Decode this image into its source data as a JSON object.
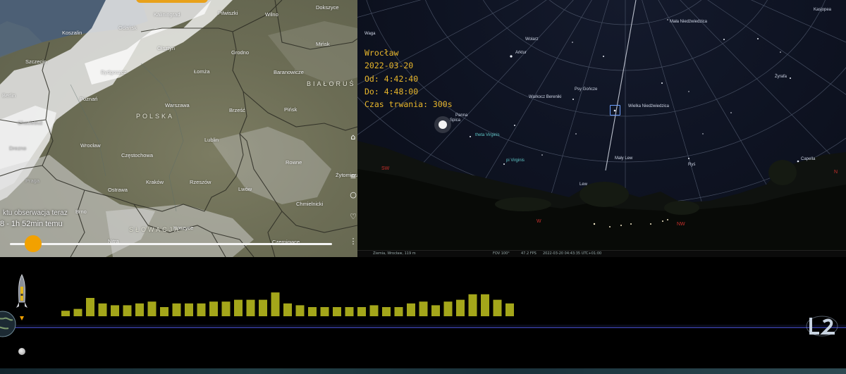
{
  "map": {
    "country_labels": [
      "POLSKA",
      "BIAŁORUŚ",
      "SŁOWACJA"
    ],
    "cities": [
      "Kaliningrad",
      "Pilwiszki",
      "Wilno",
      "Dokszyce",
      "Koszalin",
      "Gdańsk",
      "Olsztyn",
      "Grodno",
      "Mińsk",
      "Szczecin",
      "Bydgoszcz",
      "Łomża",
      "Baranowicze",
      "Berlin",
      "Poznań",
      "Warszawa",
      "Brześć",
      "Pińsk",
      "Chociebuż",
      "Wrocław",
      "Lublin",
      "Częstochowa",
      "Drezno",
      "Rowne",
      "Praga",
      "Kraków",
      "Rzeszów",
      "Żytomierz",
      "Ostrawa",
      "Lwów",
      "Chmielnicki",
      "Brno",
      "Koszyce",
      "Nitra",
      "Czerniowce"
    ],
    "timeline_label": "ktu obserwacja teraz",
    "timeline_sub": "8 - 1h 52min temu",
    "slider_value": 0.05,
    "side_icons": [
      "home-icon",
      "menu-icon",
      "layers-icon",
      "heart-icon",
      "more-icon"
    ]
  },
  "sky": {
    "event": {
      "city": "Wrocław",
      "date": "2022-03-20",
      "from": "Od: 4:42:40",
      "to": "Do: 4:48:00",
      "duration": "Czas trwania: 300s"
    },
    "labels": [
      "Kasjopea",
      "Mała Niedźwiedzica",
      "Waga",
      "Wolarz",
      "Arktur",
      "Psy Gończe",
      "Warkocz Bereniki",
      "Wielka Niedźwiedzica",
      "Żyrafa",
      "Panna",
      "Spica",
      "theta Virginis",
      "pi Virginis",
      "Mały Lew",
      "Ryś",
      "Capella",
      "Lew"
    ],
    "directions": [
      "SW",
      "W",
      "NW",
      "N"
    ],
    "status": {
      "location": "Ziemia, Wrocław, 119 m",
      "fov": "FOV 100°",
      "fps": "47.2 FPS",
      "datetime": "2022-03-20 04:43:35 UTC+01:00"
    }
  },
  "radio": {
    "bar_color": "#a4a61a",
    "axis_color": "#2a2f7c",
    "values": [
      3,
      4,
      10,
      7,
      6,
      6,
      7,
      8,
      5,
      7,
      7,
      7,
      8,
      8,
      9,
      9,
      9,
      13,
      7,
      6,
      5,
      5,
      5,
      5,
      5,
      6,
      5,
      5,
      7,
      8,
      6,
      8,
      9,
      12,
      12,
      9,
      7
    ]
  }
}
